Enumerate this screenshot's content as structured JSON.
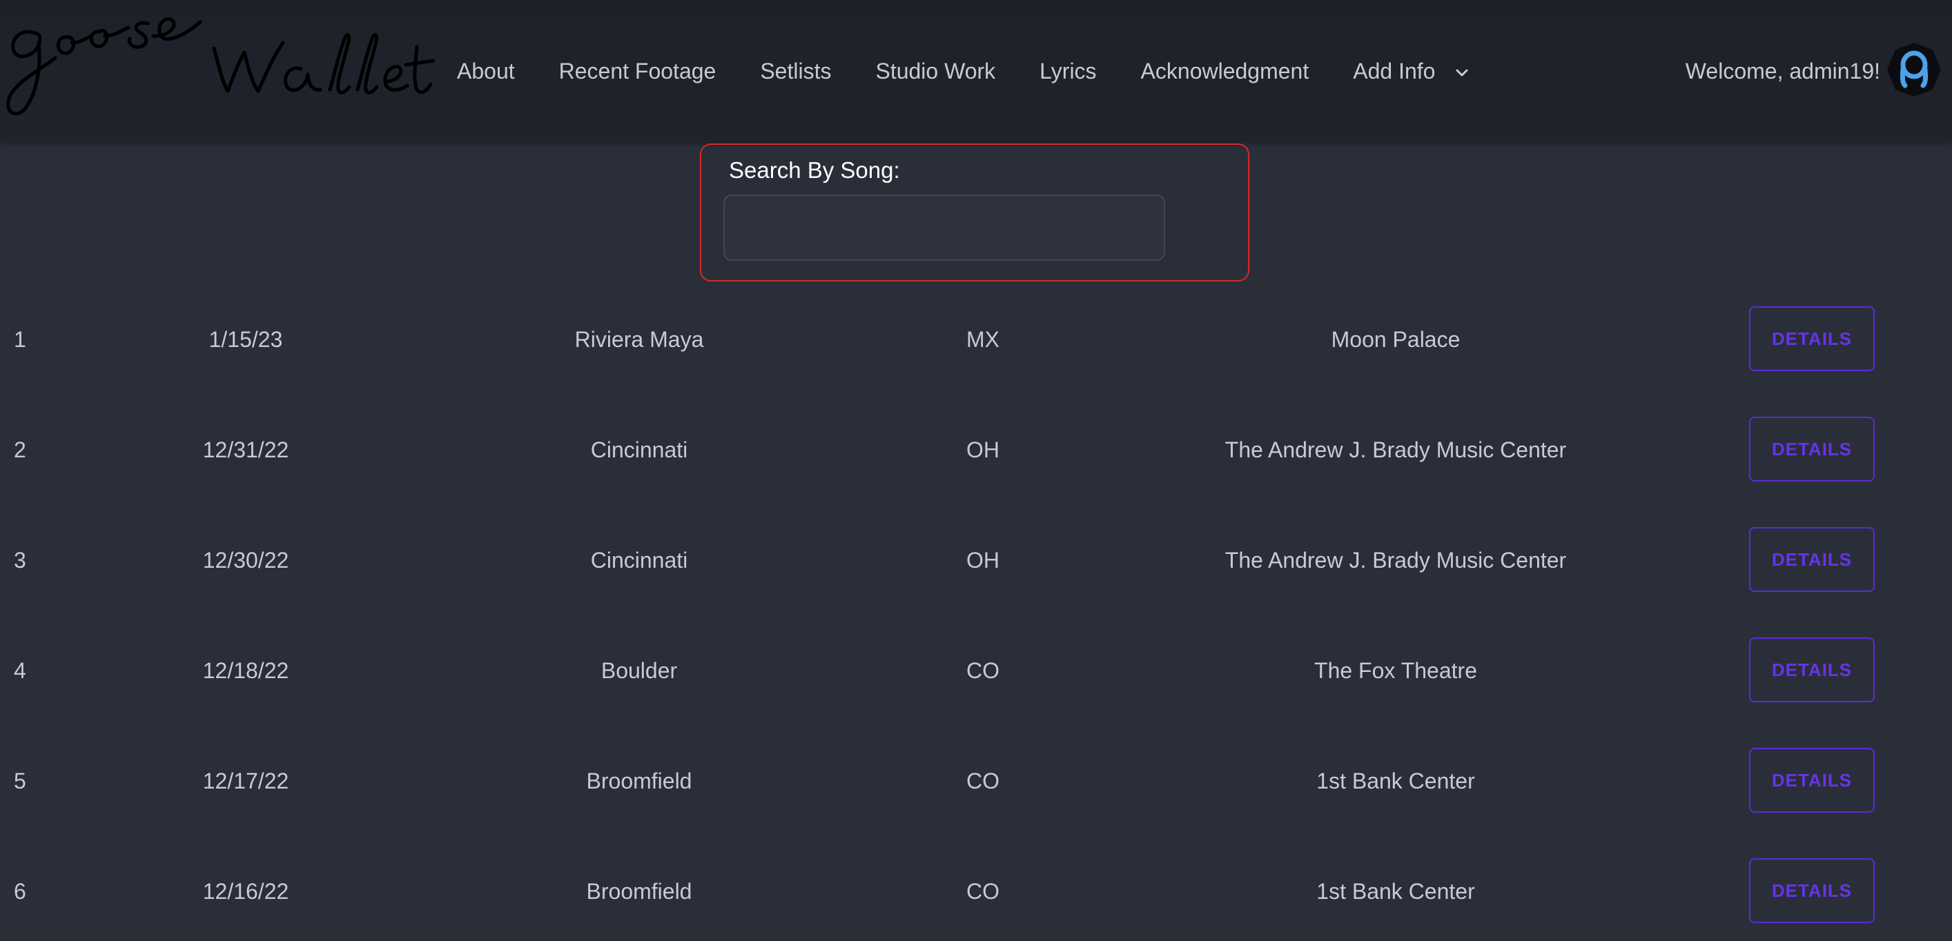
{
  "header": {
    "nav_items": [
      {
        "label": "About"
      },
      {
        "label": "Recent Footage"
      },
      {
        "label": "Setlists"
      },
      {
        "label": "Studio Work"
      },
      {
        "label": "Lyrics"
      },
      {
        "label": "Acknowledgment"
      },
      {
        "label": "Add Info",
        "icon": "chevron-down-icon"
      }
    ],
    "welcome_text": "Welcome, admin19!",
    "avatar_icon": "user-avatar-icon"
  },
  "search": {
    "label": "Search By Song:",
    "value": "",
    "placeholder": ""
  },
  "shows": {
    "button_label": "DETAILS",
    "rows": [
      {
        "index": "1",
        "date": "1/15/23",
        "city": "Riviera Maya",
        "state": "MX",
        "venue": "Moon Palace"
      },
      {
        "index": "2",
        "date": "12/31/22",
        "city": "Cincinnati",
        "state": "OH",
        "venue": "The Andrew J. Brady Music Center"
      },
      {
        "index": "3",
        "date": "12/30/22",
        "city": "Cincinnati",
        "state": "OH",
        "venue": "The Andrew J. Brady Music Center"
      },
      {
        "index": "4",
        "date": "12/18/22",
        "city": "Boulder",
        "state": "CO",
        "venue": "The Fox Theatre"
      },
      {
        "index": "5",
        "date": "12/17/22",
        "city": "Broomfield",
        "state": "CO",
        "venue": "1st Bank Center"
      },
      {
        "index": "6",
        "date": "12/16/22",
        "city": "Broomfield",
        "state": "CO",
        "venue": "1st Bank Center"
      }
    ]
  },
  "colors": {
    "background": "#2a2e39",
    "navbar": "#1f2229",
    "search_border": "#d42a2a",
    "button_accent": "#5a2bd8",
    "avatar_accent": "#4aa3ea"
  }
}
